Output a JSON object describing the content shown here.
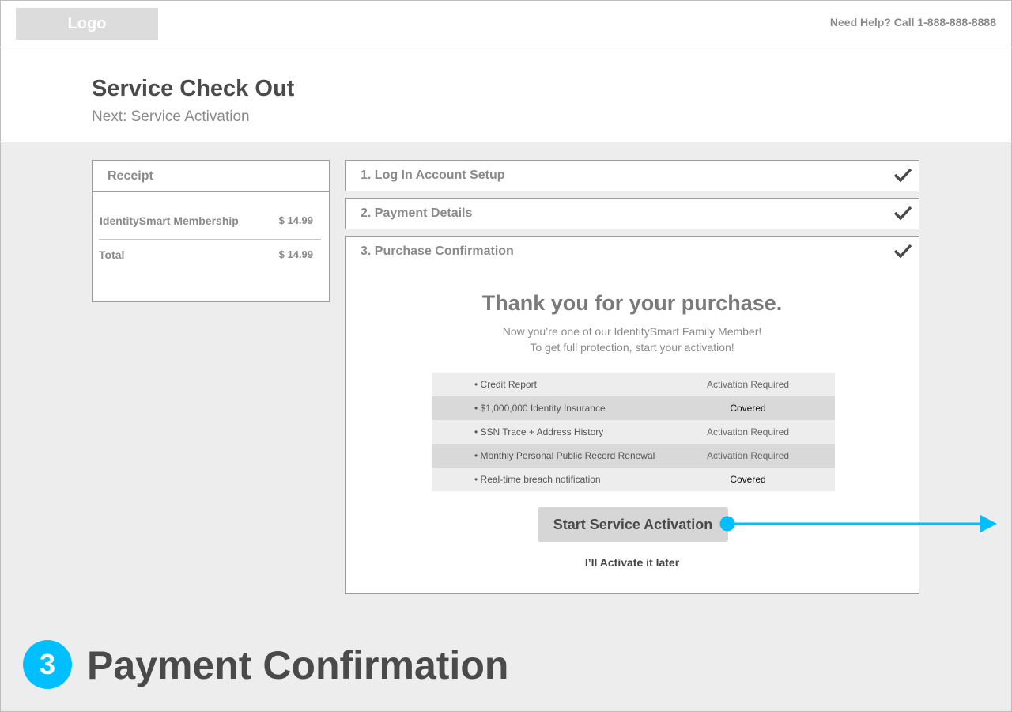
{
  "topbar": {
    "logo_label": "Logo",
    "help_text": "Need Help? Call 1-888-888-8888"
  },
  "header": {
    "title": "Service Check Out",
    "subtitle": "Next: Service Activation"
  },
  "receipt": {
    "heading": "Receipt",
    "item_name": "IdentitySmart Membership",
    "item_price": "$ 14.99",
    "total_label": "Total",
    "total_price": "$ 14.99"
  },
  "steps": [
    {
      "label": "1. Log In Account Setup",
      "icon": "checkmark-icon"
    },
    {
      "label": "2. Payment Details",
      "icon": "checkmark-icon"
    },
    {
      "label": "3. Purchase Confirmation",
      "icon": "checkmark-icon"
    }
  ],
  "confirmation": {
    "heading": "Thank you for your purchase.",
    "line1": "Now you’re one of our IdentitySmart Family Member!",
    "line2": "To get full protection, start your activation!",
    "features": [
      {
        "name": "• Credit Report",
        "status": "Activation Required"
      },
      {
        "name": "• $1,000,000 Identity Insurance",
        "status": "Covered"
      },
      {
        "name": "• SSN Trace + Address History",
        "status": "Activation Required"
      },
      {
        "name": "• Monthly Personal Public Record Renewal",
        "status": "Activation Required"
      },
      {
        "name": "• Real-time breach notification",
        "status": "Covered"
      }
    ],
    "primary_button": "Start Service Activation",
    "secondary_link": "I’ll Activate it later"
  },
  "annotation": {
    "step_number": "3",
    "title": "Payment Confirmation",
    "accent_color": "#00bfff"
  }
}
